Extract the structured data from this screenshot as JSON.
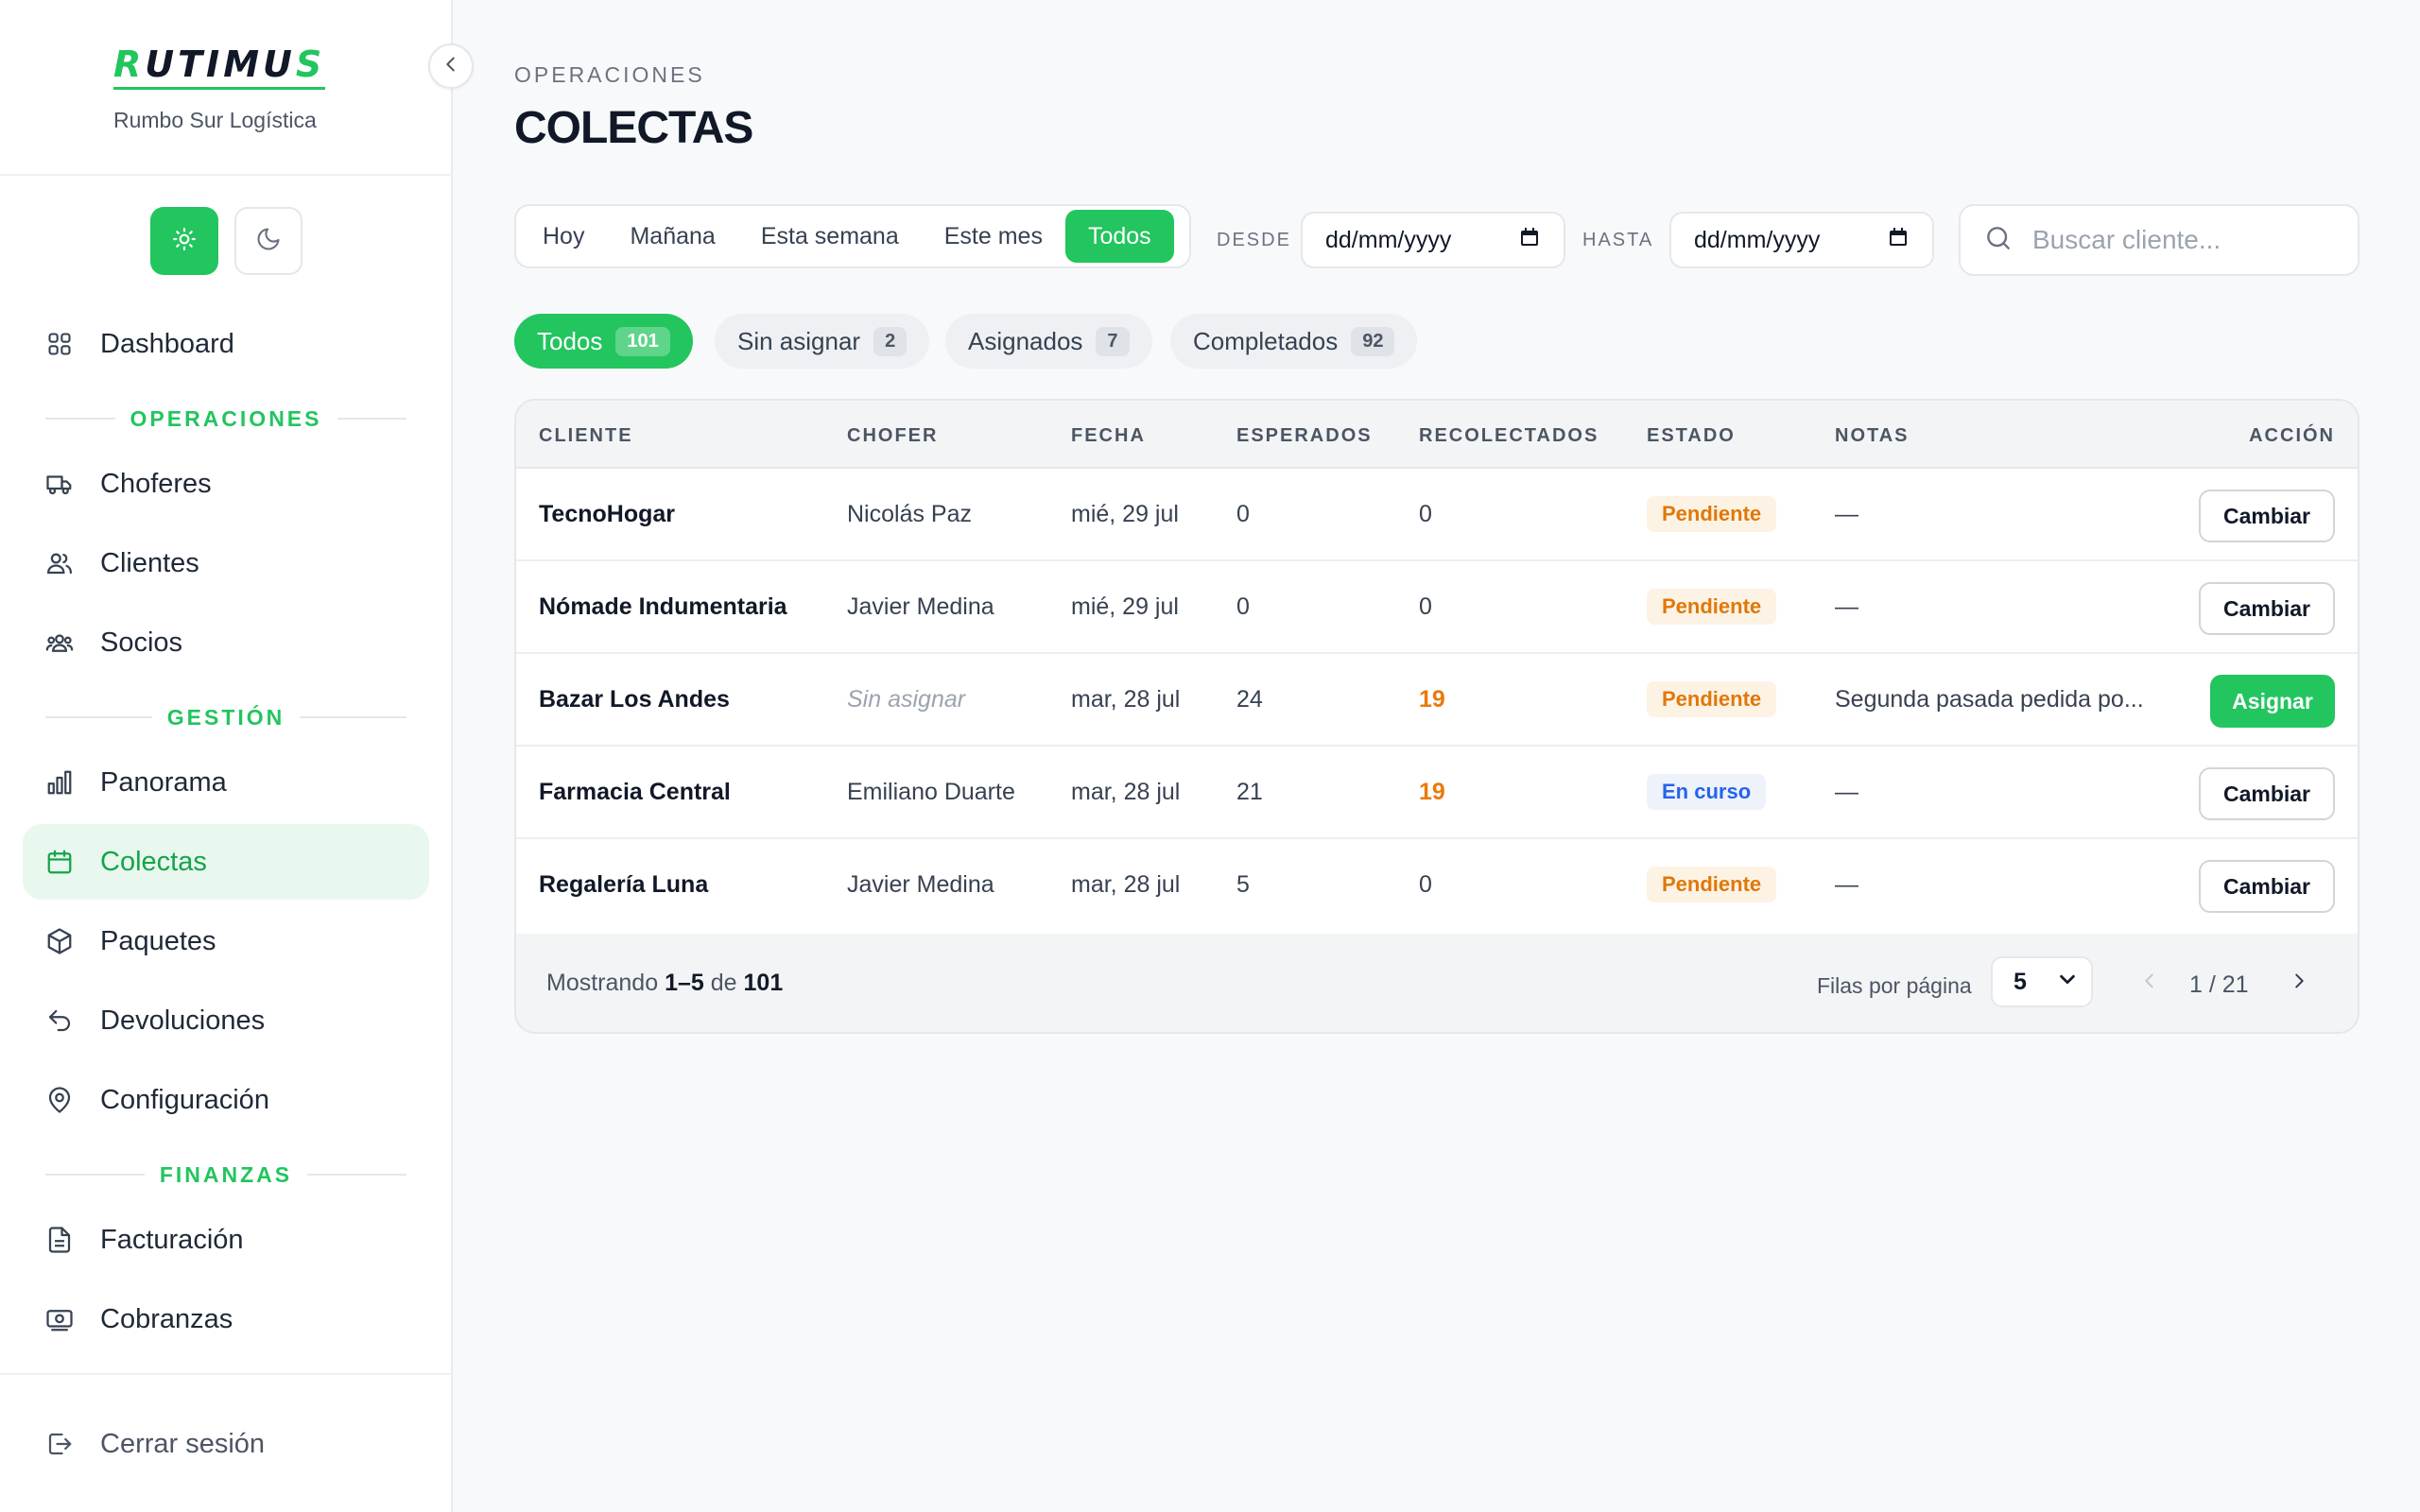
{
  "brand": {
    "logo": "RUTIMUS",
    "subtitle": "Rumbo Sur Logística"
  },
  "sidebar": {
    "top_items": [
      {
        "label": "Dashboard",
        "icon": "grid-icon"
      }
    ],
    "sections": [
      {
        "title": "OPERACIONES",
        "items": [
          {
            "label": "Choferes",
            "icon": "truck-icon"
          },
          {
            "label": "Clientes",
            "icon": "users-icon"
          },
          {
            "label": "Socios",
            "icon": "group-icon"
          }
        ]
      },
      {
        "title": "GESTIÓN",
        "items": [
          {
            "label": "Panorama",
            "icon": "bar-chart-icon"
          },
          {
            "label": "Colectas",
            "icon": "calendar-icon",
            "active": true
          },
          {
            "label": "Paquetes",
            "icon": "box-icon"
          },
          {
            "label": "Devoluciones",
            "icon": "undo-icon"
          },
          {
            "label": "Configuración",
            "icon": "map-pin-icon"
          }
        ]
      },
      {
        "title": "FINANZAS",
        "items": [
          {
            "label": "Facturación",
            "icon": "file-icon"
          },
          {
            "label": "Cobranzas",
            "icon": "banknote-icon"
          }
        ]
      }
    ],
    "logout": "Cerrar sesión"
  },
  "header": {
    "eyebrow": "OPERACIONES",
    "title": "COLECTAS"
  },
  "filters": {
    "ranges": [
      "Hoy",
      "Mañana",
      "Esta semana",
      "Este mes",
      "Todos"
    ],
    "active_range": "Todos",
    "from_label": "DESDE",
    "to_label": "HASTA",
    "date_placeholder": "dd/mm/yyyy",
    "search_placeholder": "Buscar cliente..."
  },
  "status_tabs": [
    {
      "label": "Todos",
      "count": "101",
      "active": true
    },
    {
      "label": "Sin asignar",
      "count": "2"
    },
    {
      "label": "Asignados",
      "count": "7"
    },
    {
      "label": "Completados",
      "count": "92"
    }
  ],
  "table": {
    "columns": [
      "CLIENTE",
      "CHOFER",
      "FECHA",
      "ESPERADOS",
      "RECOLECTADOS",
      "ESTADO",
      "NOTAS",
      "ACCIÓN"
    ],
    "rows": [
      {
        "cliente": "TecnoHogar",
        "chofer": "Nicolás Paz",
        "fecha": "mié, 29 jul",
        "esperados": "0",
        "recolectados": "0",
        "estado": "Pendiente",
        "notas": "—",
        "accion": "Cambiar"
      },
      {
        "cliente": "Nómade Indumentaria",
        "chofer": "Javier Medina",
        "fecha": "mié, 29 jul",
        "esperados": "0",
        "recolectados": "0",
        "estado": "Pendiente",
        "notas": "—",
        "accion": "Cambiar"
      },
      {
        "cliente": "Bazar Los Andes",
        "chofer": "Sin asignar",
        "fecha": "mar, 28 jul",
        "esperados": "24",
        "recolectados": "19",
        "estado": "Pendiente",
        "notas": "Segunda pasada pedida po...",
        "accion": "Asignar"
      },
      {
        "cliente": "Farmacia Central",
        "chofer": "Emiliano Duarte",
        "fecha": "mar, 28 jul",
        "esperados": "21",
        "recolectados": "19",
        "estado": "En curso",
        "notas": "—",
        "accion": "Cambiar"
      },
      {
        "cliente": "Regalería Luna",
        "chofer": "Javier Medina",
        "fecha": "mar, 28 jul",
        "esperados": "5",
        "recolectados": "0",
        "estado": "Pendiente",
        "notas": "—",
        "accion": "Cambiar"
      }
    ]
  },
  "footer": {
    "showing_prefix": "Mostrando",
    "showing_range": "1–5",
    "showing_of": "de",
    "showing_total": "101",
    "rows_per_page_label": "Filas por página",
    "rows_per_page": "5",
    "page": "1 / 21"
  },
  "colors": {
    "accent": "#22c55e",
    "pending": "#e0780a",
    "in_progress": "#2563eb",
    "highlight_number": "#ea7a0c"
  }
}
